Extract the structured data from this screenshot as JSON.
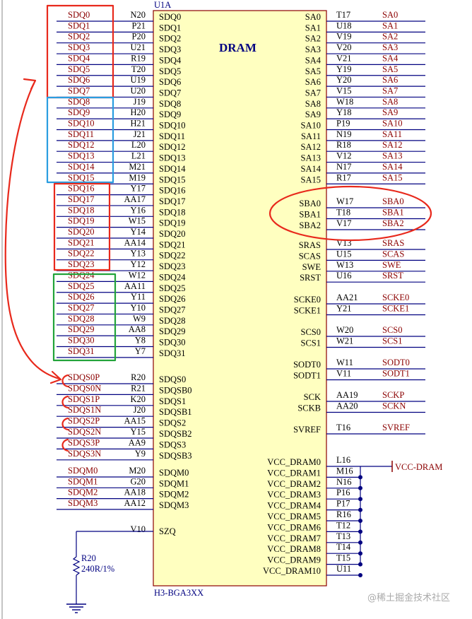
{
  "component": {
    "designator": "U1A",
    "title": "DRAM",
    "footprint": "H3-BGA3XX"
  },
  "left_pins": [
    {
      "name": "SDQ0",
      "num": "N20",
      "net": "SDQ0"
    },
    {
      "name": "SDQ1",
      "num": "P21",
      "net": "SDQ1"
    },
    {
      "name": "SDQ2",
      "num": "P20",
      "net": "SDQ2"
    },
    {
      "name": "SDQ3",
      "num": "U21",
      "net": "SDQ3"
    },
    {
      "name": "SDQ4",
      "num": "R19",
      "net": "SDQ4"
    },
    {
      "name": "SDQ5",
      "num": "T20",
      "net": "SDQ5"
    },
    {
      "name": "SDQ6",
      "num": "U19",
      "net": "SDQ6"
    },
    {
      "name": "SDQ7",
      "num": "U20",
      "net": "SDQ7"
    },
    {
      "name": "SDQ8",
      "num": "J19",
      "net": "SDQ8"
    },
    {
      "name": "SDQ9",
      "num": "H20",
      "net": "SDQ9"
    },
    {
      "name": "SDQ10",
      "num": "H21",
      "net": "SDQ10"
    },
    {
      "name": "SDQ11",
      "num": "J21",
      "net": "SDQ11"
    },
    {
      "name": "SDQ12",
      "num": "L20",
      "net": "SDQ12"
    },
    {
      "name": "SDQ13",
      "num": "L21",
      "net": "SDQ13"
    },
    {
      "name": "SDQ14",
      "num": "M21",
      "net": "SDQ14"
    },
    {
      "name": "SDQ15",
      "num": "M19",
      "net": "SDQ15"
    },
    {
      "name": "SDQ16",
      "num": "Y17",
      "net": "SDQ16"
    },
    {
      "name": "SDQ17",
      "num": "AA17",
      "net": "SDQ17"
    },
    {
      "name": "SDQ18",
      "num": "Y16",
      "net": "SDQ18"
    },
    {
      "name": "SDQ19",
      "num": "W15",
      "net": "SDQ19"
    },
    {
      "name": "SDQ20",
      "num": "Y14",
      "net": "SDQ20"
    },
    {
      "name": "SDQ21",
      "num": "AA14",
      "net": "SDQ21"
    },
    {
      "name": "SDQ22",
      "num": "Y13",
      "net": "SDQ22"
    },
    {
      "name": "SDQ23",
      "num": "Y12",
      "net": "SDQ23"
    },
    {
      "name": "SDQ24",
      "num": "W12",
      "net": "SDQ24"
    },
    {
      "name": "SDQ25",
      "num": "AA11",
      "net": "SDQ25"
    },
    {
      "name": "SDQ26",
      "num": "Y11",
      "net": "SDQ26"
    },
    {
      "name": "SDQ27",
      "num": "Y10",
      "net": "SDQ27"
    },
    {
      "name": "SDQ28",
      "num": "W9",
      "net": "SDQ28"
    },
    {
      "name": "SDQ29",
      "num": "AA8",
      "net": "SDQ29"
    },
    {
      "name": "SDQ30",
      "num": "Y8",
      "net": "SDQ30"
    },
    {
      "name": "SDQ31",
      "num": "Y7",
      "net": "SDQ31"
    },
    {
      "name": "SDQS0",
      "num": "R20",
      "net": "SDQS0P"
    },
    {
      "name": "SDQSB0",
      "num": "R21",
      "net": "SDQS0N"
    },
    {
      "name": "SDQS1",
      "num": "K20",
      "net": "SDQS1P"
    },
    {
      "name": "SDQSB1",
      "num": "J20",
      "net": "SDQS1N"
    },
    {
      "name": "SDQS2",
      "num": "AA15",
      "net": "SDQS2P"
    },
    {
      "name": "SDQSB2",
      "num": "Y15",
      "net": "SDQS2N"
    },
    {
      "name": "SDQS3",
      "num": "AA9",
      "net": "SDQS3P"
    },
    {
      "name": "SDQSB3",
      "num": "Y9",
      "net": "SDQS3N"
    },
    {
      "name": "SDQM0",
      "num": "M20",
      "net": "SDQM0"
    },
    {
      "name": "SDQM1",
      "num": "G20",
      "net": "SDQM1"
    },
    {
      "name": "SDQM2",
      "num": "AA18",
      "net": "SDQM2"
    },
    {
      "name": "SDQM3",
      "num": "AA12",
      "net": "SDQM3"
    },
    {
      "name": "SZQ",
      "num": "V10",
      "net": ""
    }
  ],
  "right_pins": [
    {
      "name": "SA0",
      "num": "T17",
      "net": "SA0"
    },
    {
      "name": "SA1",
      "num": "U18",
      "net": "SA1"
    },
    {
      "name": "SA2",
      "num": "V19",
      "net": "SA2"
    },
    {
      "name": "SA3",
      "num": "V20",
      "net": "SA3"
    },
    {
      "name": "SA4",
      "num": "V21",
      "net": "SA4"
    },
    {
      "name": "SA5",
      "num": "Y19",
      "net": "SA5"
    },
    {
      "name": "SA6",
      "num": "Y20",
      "net": "SA6"
    },
    {
      "name": "SA7",
      "num": "V15",
      "net": "SA7"
    },
    {
      "name": "SA8",
      "num": "W18",
      "net": "SA8"
    },
    {
      "name": "SA9",
      "num": "Y18",
      "net": "SA9"
    },
    {
      "name": "SA10",
      "num": "P19",
      "net": "SA10"
    },
    {
      "name": "SA11",
      "num": "N19",
      "net": "SA11"
    },
    {
      "name": "SA12",
      "num": "R18",
      "net": "SA12"
    },
    {
      "name": "SA13",
      "num": "V12",
      "net": "SA13"
    },
    {
      "name": "SA14",
      "num": "N17",
      "net": "SA14"
    },
    {
      "name": "SA15",
      "num": "R17",
      "net": "SA15"
    },
    {
      "name": "SBA0",
      "num": "W17",
      "net": "SBA0"
    },
    {
      "name": "SBA1",
      "num": "T18",
      "net": "SBA1"
    },
    {
      "name": "SBA2",
      "num": "V17",
      "net": "SBA2"
    },
    {
      "name": "SRAS",
      "num": "V13",
      "net": "SRAS"
    },
    {
      "name": "SCAS",
      "num": "U15",
      "net": "SCAS"
    },
    {
      "name": "SWE",
      "num": "W13",
      "net": "SWE"
    },
    {
      "name": "SRST",
      "num": "U16",
      "net": "SRST"
    },
    {
      "name": "SCKE0",
      "num": "AA21",
      "net": "SCKE0"
    },
    {
      "name": "SCKE1",
      "num": "Y21",
      "net": "SCKE1"
    },
    {
      "name": "SCS0",
      "num": "W20",
      "net": "SCS0"
    },
    {
      "name": "SCS1",
      "num": "W21",
      "net": "SCS1"
    },
    {
      "name": "SODT0",
      "num": "W11",
      "net": "SODT0"
    },
    {
      "name": "SODT1",
      "num": "V11",
      "net": "SODT1"
    },
    {
      "name": "SCK",
      "num": "AA19",
      "net": "SCKP"
    },
    {
      "name": "SCKB",
      "num": "AA20",
      "net": "SCKN"
    },
    {
      "name": "SVREF",
      "num": "T16",
      "net": "SVREF"
    },
    {
      "name": "VCC_DRAM0",
      "num": "L16",
      "net": ""
    },
    {
      "name": "VCC_DRAM1",
      "num": "M16",
      "net": ""
    },
    {
      "name": "VCC_DRAM2",
      "num": "N16",
      "net": ""
    },
    {
      "name": "VCC_DRAM3",
      "num": "P16",
      "net": ""
    },
    {
      "name": "VCC_DRAM4",
      "num": "P17",
      "net": ""
    },
    {
      "name": "VCC_DRAM5",
      "num": "R16",
      "net": ""
    },
    {
      "name": "VCC_DRAM6",
      "num": "T12",
      "net": ""
    },
    {
      "name": "VCC_DRAM7",
      "num": "T13",
      "net": ""
    },
    {
      "name": "VCC_DRAM8",
      "num": "T14",
      "net": ""
    },
    {
      "name": "VCC_DRAM9",
      "num": "T15",
      "net": ""
    },
    {
      "name": "VCC_DRAM10",
      "num": "U11",
      "net": ""
    }
  ],
  "power_label": "VCC-DRAM",
  "resistor": {
    "ref": "R20",
    "value": "240R/1%"
  },
  "watermark": "@稀土掘金技术社区",
  "colors": {
    "body_fill": "#ffffc0",
    "body_stroke": "#8b0000",
    "wire": "#000080",
    "net": "#8b0000",
    "red_mark": "#e8291c",
    "blue_mark": "#2a9de0",
    "green_mark": "#22a33a"
  }
}
